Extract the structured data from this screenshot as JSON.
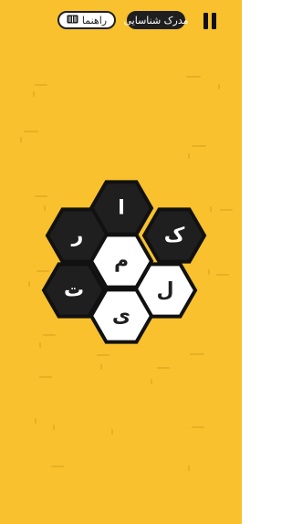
{
  "top_bar": {
    "guide_label": "راهنما",
    "guide_icon": "book-icon",
    "badge_label": "مدرک شناسایی",
    "pause_icon": "pause-icon"
  },
  "board": {
    "colors": {
      "background": "#f8c12d",
      "dark_tile": "#1f1f1f",
      "light_tile": "#ffffff",
      "tile_outline": "#111111"
    },
    "tiles": [
      {
        "letter": "ا",
        "type": "dark"
      },
      {
        "letter": "ک",
        "type": "dark"
      },
      {
        "letter": "ر",
        "type": "dark"
      },
      {
        "letter": "م",
        "type": "light"
      },
      {
        "letter": "ت",
        "type": "dark"
      },
      {
        "letter": "ل",
        "type": "light"
      },
      {
        "letter": "ی",
        "type": "light"
      }
    ]
  }
}
